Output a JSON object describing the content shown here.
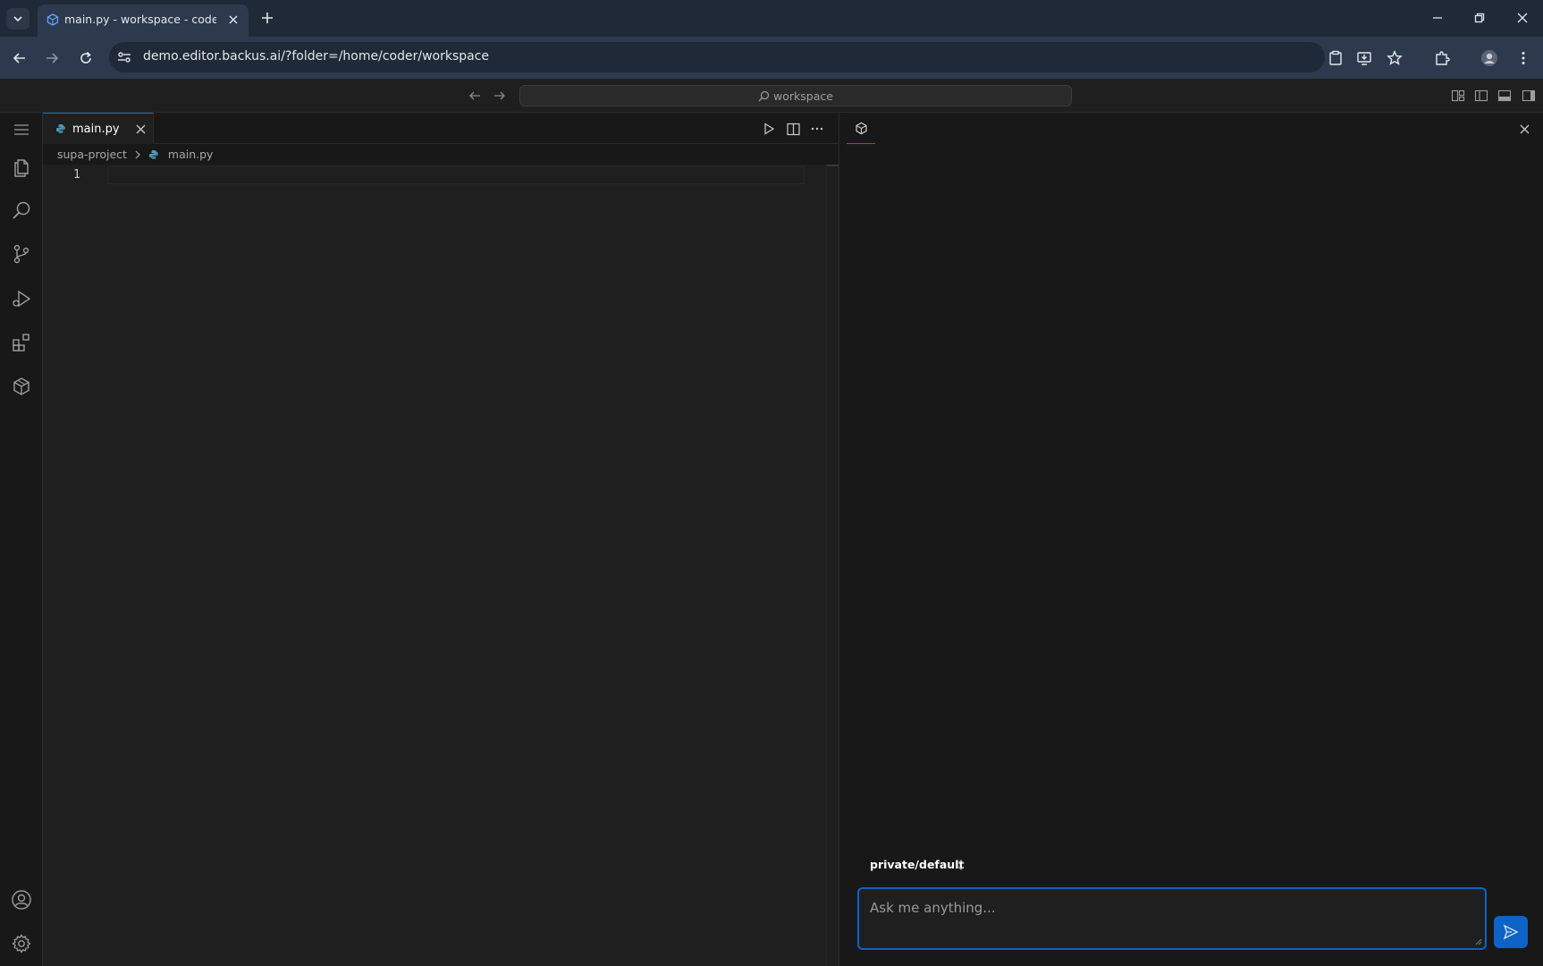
{
  "browser": {
    "tab_title": "main.py - workspace - code-server",
    "url": "demo.editor.backus.ai/?folder=/home/coder/workspace"
  },
  "vscode": {
    "command_center": "workspace",
    "editor": {
      "tab_label": "main.py",
      "breadcrumb": [
        "supa-project",
        "main.py"
      ],
      "line_numbers": [
        "1"
      ]
    },
    "chat": {
      "model": "private/default",
      "input_placeholder": "Ask me anything..."
    }
  },
  "colors": {
    "accent": "#0e63c7",
    "python_icon": "#519aba"
  }
}
